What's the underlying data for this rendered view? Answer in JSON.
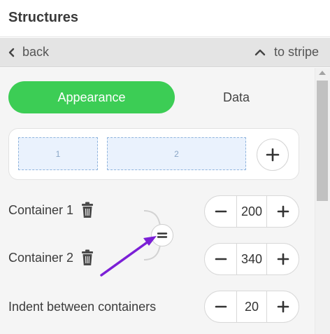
{
  "header": {
    "title": "Structures"
  },
  "nav": {
    "back_label": "back",
    "stripe_label": "to stripe"
  },
  "tabs": {
    "appearance": "Appearance",
    "data": "Data"
  },
  "preview": {
    "block1": "1",
    "block2": "2"
  },
  "containers": [
    {
      "label": "Container 1",
      "value": "200"
    },
    {
      "label": "Container 2",
      "value": "340"
    }
  ],
  "indent": {
    "label": "Indent between containers",
    "value": "20"
  },
  "colors": {
    "accent_green": "#3ccd55",
    "annotation_purple": "#7b1fd6",
    "block_fill": "#eaf2fd"
  },
  "icons": [
    "chevron-left-icon",
    "chevron-up-icon",
    "plus-icon",
    "minus-icon",
    "trash-icon",
    "equals-icon",
    "arrow-icon"
  ]
}
